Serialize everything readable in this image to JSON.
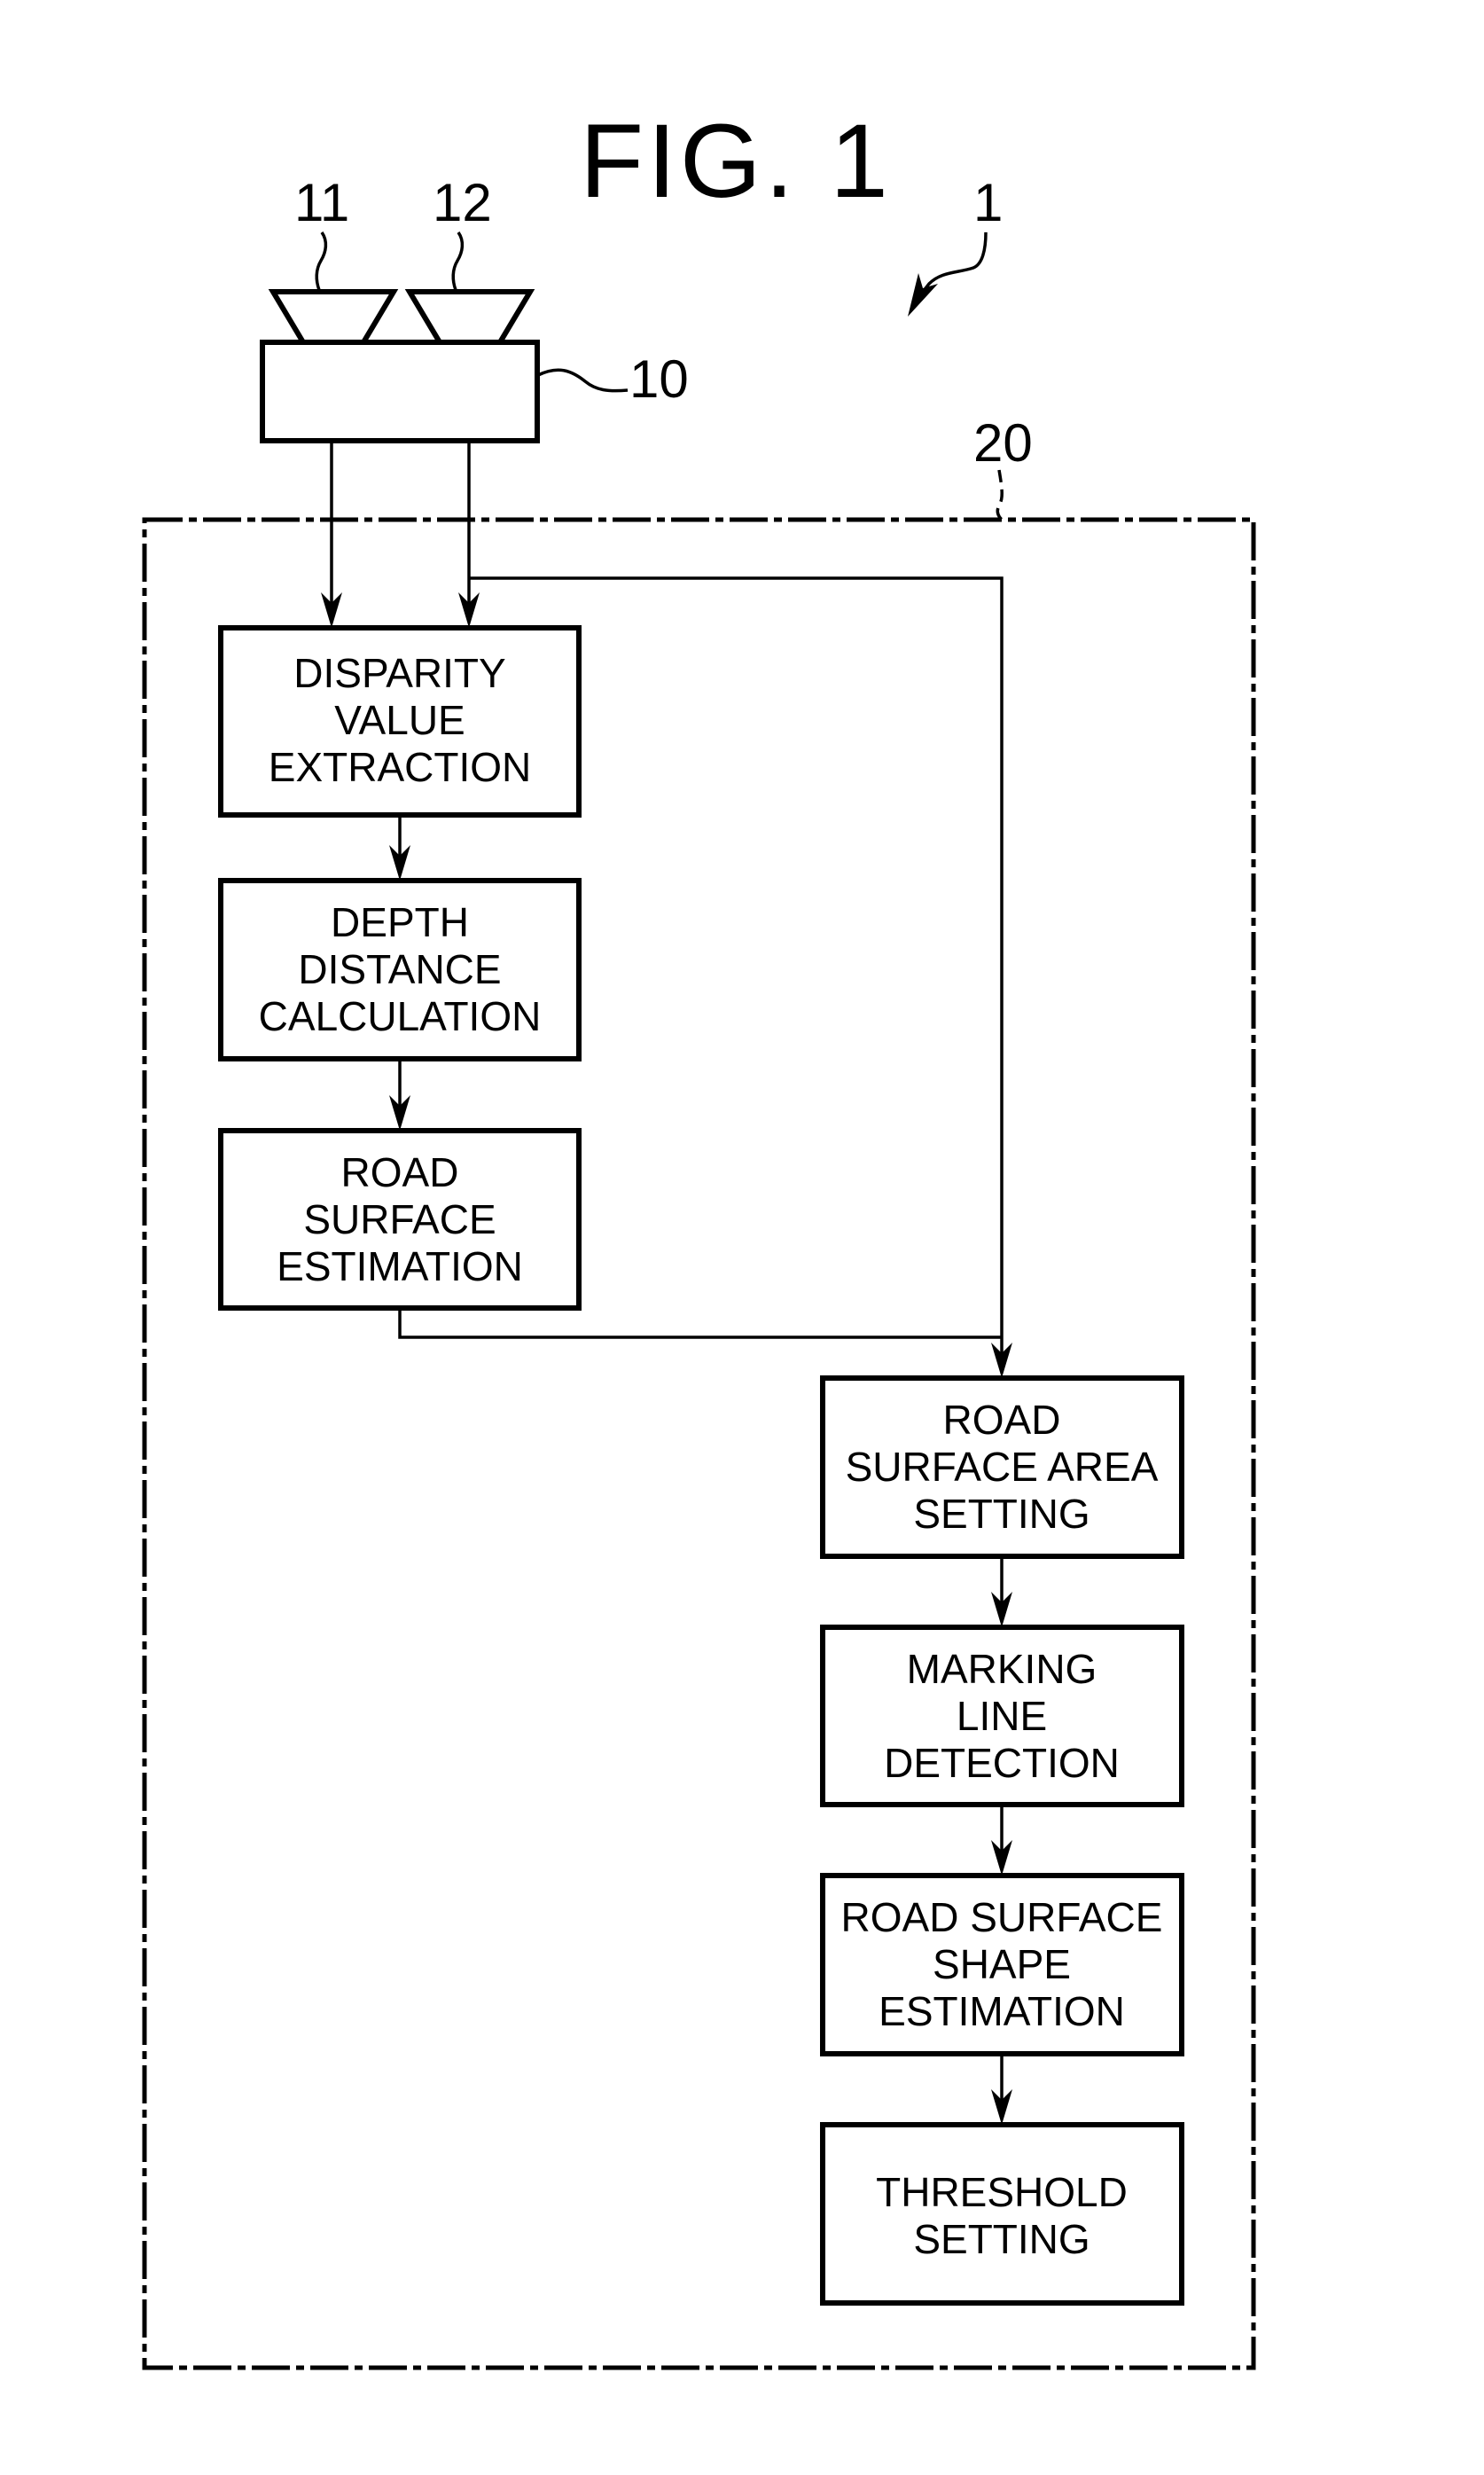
{
  "figure": {
    "title": "FIG. 1"
  },
  "reference_labels": {
    "system": "1",
    "camera_unit": "10",
    "camera_left": "11",
    "camera_right": "12",
    "processing_unit": "20"
  },
  "blocks": {
    "disparity": {
      "lines": [
        "DISPARITY",
        "VALUE",
        "EXTRACTION"
      ]
    },
    "depth": {
      "lines": [
        "DEPTH",
        "DISTANCE",
        "CALCULATION"
      ]
    },
    "road_surface_estimation": {
      "lines": [
        "ROAD",
        "SURFACE",
        "ESTIMATION"
      ]
    },
    "road_surface_area_setting": {
      "lines": [
        "ROAD",
        "SURFACE AREA",
        "SETTING"
      ]
    },
    "marking_line_detection": {
      "lines": [
        "MARKING",
        "LINE",
        "DETECTION"
      ]
    },
    "road_surface_shape_estimation": {
      "lines": [
        "ROAD SURFACE",
        "SHAPE",
        "ESTIMATION"
      ]
    },
    "threshold_setting": {
      "lines": [
        "THRESHOLD",
        "SETTING"
      ]
    }
  },
  "colors": {
    "stroke": "#000000",
    "background": "#ffffff"
  }
}
